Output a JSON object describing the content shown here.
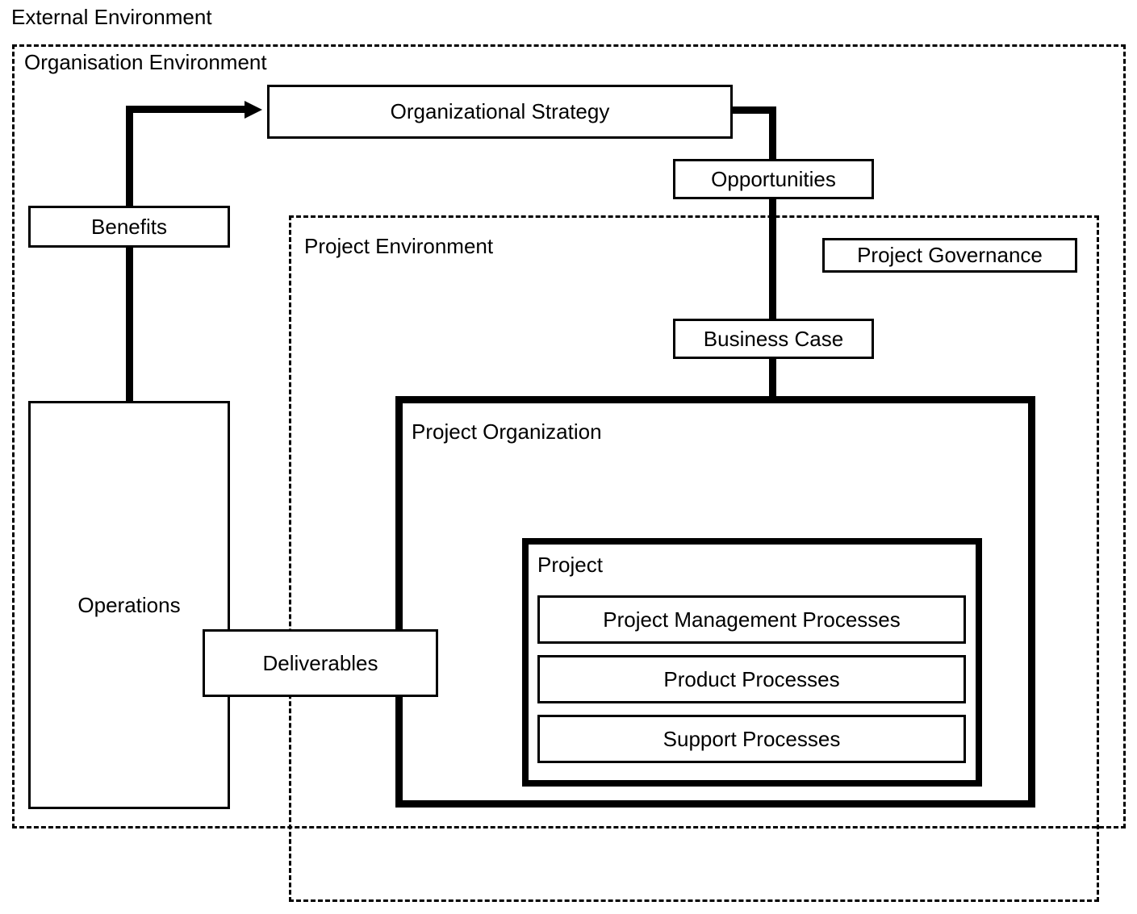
{
  "diagram": {
    "title": "External Environment",
    "frames": {
      "external": {
        "label": "External Environment"
      },
      "organisation": {
        "label": "Organisation Environment"
      },
      "project_environment": {
        "label": "Project Environment"
      },
      "project_organization": {
        "label": "Project Organization"
      },
      "project": {
        "label": "Project"
      }
    },
    "nodes": {
      "organizational_strategy": {
        "label": "Organizational Strategy"
      },
      "opportunities": {
        "label": "Opportunities"
      },
      "project_governance": {
        "label": "Project Governance"
      },
      "business_case": {
        "label": "Business Case"
      },
      "benefits": {
        "label": "Benefits"
      },
      "operations": {
        "label": "Operations"
      },
      "deliverables": {
        "label": "Deliverables"
      }
    },
    "processes": [
      {
        "label": "Project Management Processes"
      },
      {
        "label": "Product Processes"
      },
      {
        "label": "Support Processes"
      }
    ],
    "flows": [
      {
        "from": "Benefits",
        "to": "Organizational Strategy",
        "direction": "up-right"
      },
      {
        "from": "Organizational Strategy",
        "to": "Opportunities",
        "direction": "down"
      },
      {
        "from": "Opportunities",
        "to": "Business Case",
        "direction": "down"
      },
      {
        "from": "Business Case",
        "to": "Project",
        "direction": "down"
      },
      {
        "from": "Project",
        "to": "Deliverables",
        "direction": "left"
      },
      {
        "from": "Deliverables",
        "to": "Operations",
        "direction": "left"
      },
      {
        "from": "Operations",
        "to": "Benefits",
        "direction": "up"
      }
    ],
    "colors": {
      "stroke": "#000000",
      "background": "#ffffff"
    }
  }
}
